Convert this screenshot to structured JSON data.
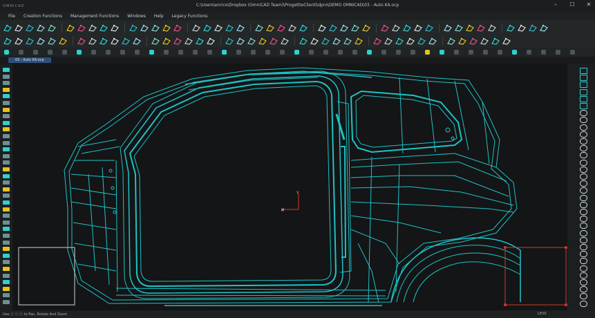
{
  "app": {
    "logo": "OMNICAD",
    "window_title": "C:\\Users\\enrico\\Dropbox (OmniCAD Team)\\ProgettieClienti\\dpro\\DEMO OMNICAD\\03 - Auto KA.ocp"
  },
  "window_controls": {
    "minimize": "–",
    "maximize": "☐",
    "close": "✕"
  },
  "menu": {
    "items": [
      "File",
      "Creation Functions",
      "Management Functions",
      "Windows",
      "Help",
      "Legacy Functions"
    ]
  },
  "tab": {
    "label": "03 - Auto KA.ocp"
  },
  "status": {
    "hint": "Use ⓘ ⓘ ⓘ to Pan, Rotate And Zoom",
    "layer": "LEV0"
  },
  "colors": {
    "accent": "#2fd0d0",
    "wireframe": "#1fc3c8",
    "viewport_bg": "#141516",
    "selection": "#d9392a",
    "yellow_icon": "#e6c21e"
  },
  "icons": {
    "ribbon": [
      "open-file-icon",
      "save-icon",
      "print-icon",
      "undo-icon",
      "point-icon",
      "line-icon",
      "curve-icon",
      "surface-icon",
      "solid-icon",
      "fillet-icon",
      "trim-icon",
      "extend-icon",
      "offset-icon",
      "mirror-icon",
      "measure-icon",
      "layer-icon",
      "view-icon",
      "render-icon",
      "export-icon",
      "settings-icon"
    ],
    "side": [
      "select-icon",
      "pan-icon",
      "rotate-icon",
      "zoom-icon",
      "fit-icon",
      "shade-icon",
      "wireframe-icon",
      "section-icon"
    ]
  }
}
